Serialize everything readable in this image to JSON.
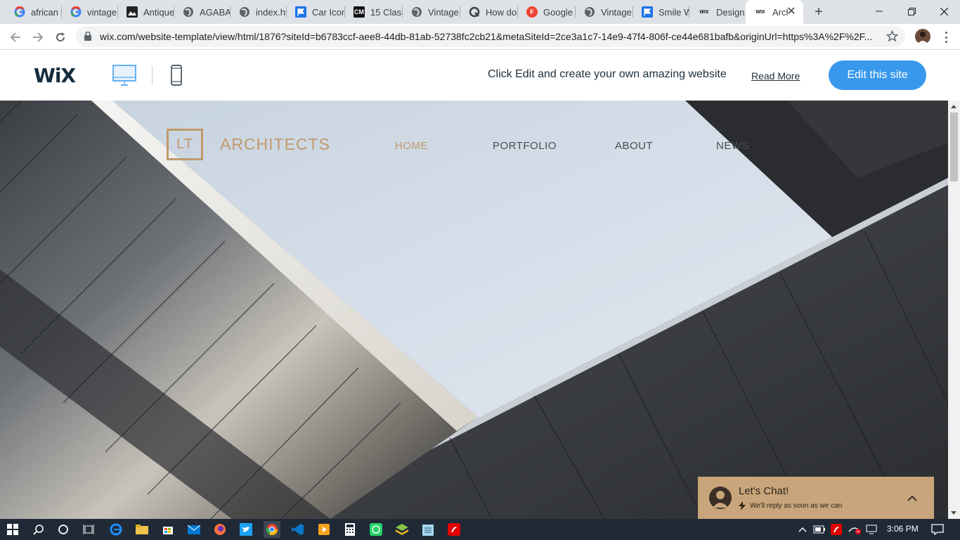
{
  "browser": {
    "tabs": [
      {
        "title": "african",
        "favicon": "google-icon"
      },
      {
        "title": "vintage",
        "favicon": "google-icon"
      },
      {
        "title": "Antique",
        "favicon": "image-icon"
      },
      {
        "title": "AGABA",
        "favicon": "globe-icon"
      },
      {
        "title": "index.ht",
        "favicon": "globe-icon"
      },
      {
        "title": "Car Icon",
        "favicon": "flag-icon"
      },
      {
        "title": "15 Class",
        "favicon": "cm-icon",
        "favicon_text": "CM"
      },
      {
        "title": "Vintage",
        "favicon": "globe-icon"
      },
      {
        "title": "How do",
        "favicon": "q-icon"
      },
      {
        "title": "Google",
        "favicon": "f-icon",
        "favicon_text": "F"
      },
      {
        "title": "Vintage",
        "favicon": "globe-icon"
      },
      {
        "title": "Smile W",
        "favicon": "flag-icon"
      },
      {
        "title": "Design",
        "favicon": "wix-icon",
        "favicon_text": "WIX"
      },
      {
        "title": "Arch",
        "favicon": "wix-icon",
        "favicon_text": "WIX",
        "active": true
      }
    ],
    "url": "wix.com/website-template/view/html/1876?siteId=b6783ccf-aee8-44db-81ab-52738fc2cb21&metaSiteId=2ce3a1c7-14e9-47f4-806f-ce44e681bafb&originUrl=https%3A%2F%2F..."
  },
  "wixbar": {
    "logo": "WiX",
    "promo": "Click Edit and create your own amazing website",
    "read_more": "Read More",
    "edit_button": "Edit this site"
  },
  "site": {
    "logo_mark": "LT",
    "brand": "ARCHITECTS",
    "menu": [
      "HOME",
      "PORTFOLIO",
      "ABOUT",
      "NEWS"
    ],
    "active_menu": "HOME",
    "colors": {
      "accent": "#c09a6b",
      "menu": "#4b4d52",
      "chat": "#c9a57b"
    }
  },
  "chat": {
    "title": "Let's Chat!",
    "subtitle": "We'll reply as soon as we can"
  },
  "taskbar": {
    "time": "3:06 PM"
  }
}
